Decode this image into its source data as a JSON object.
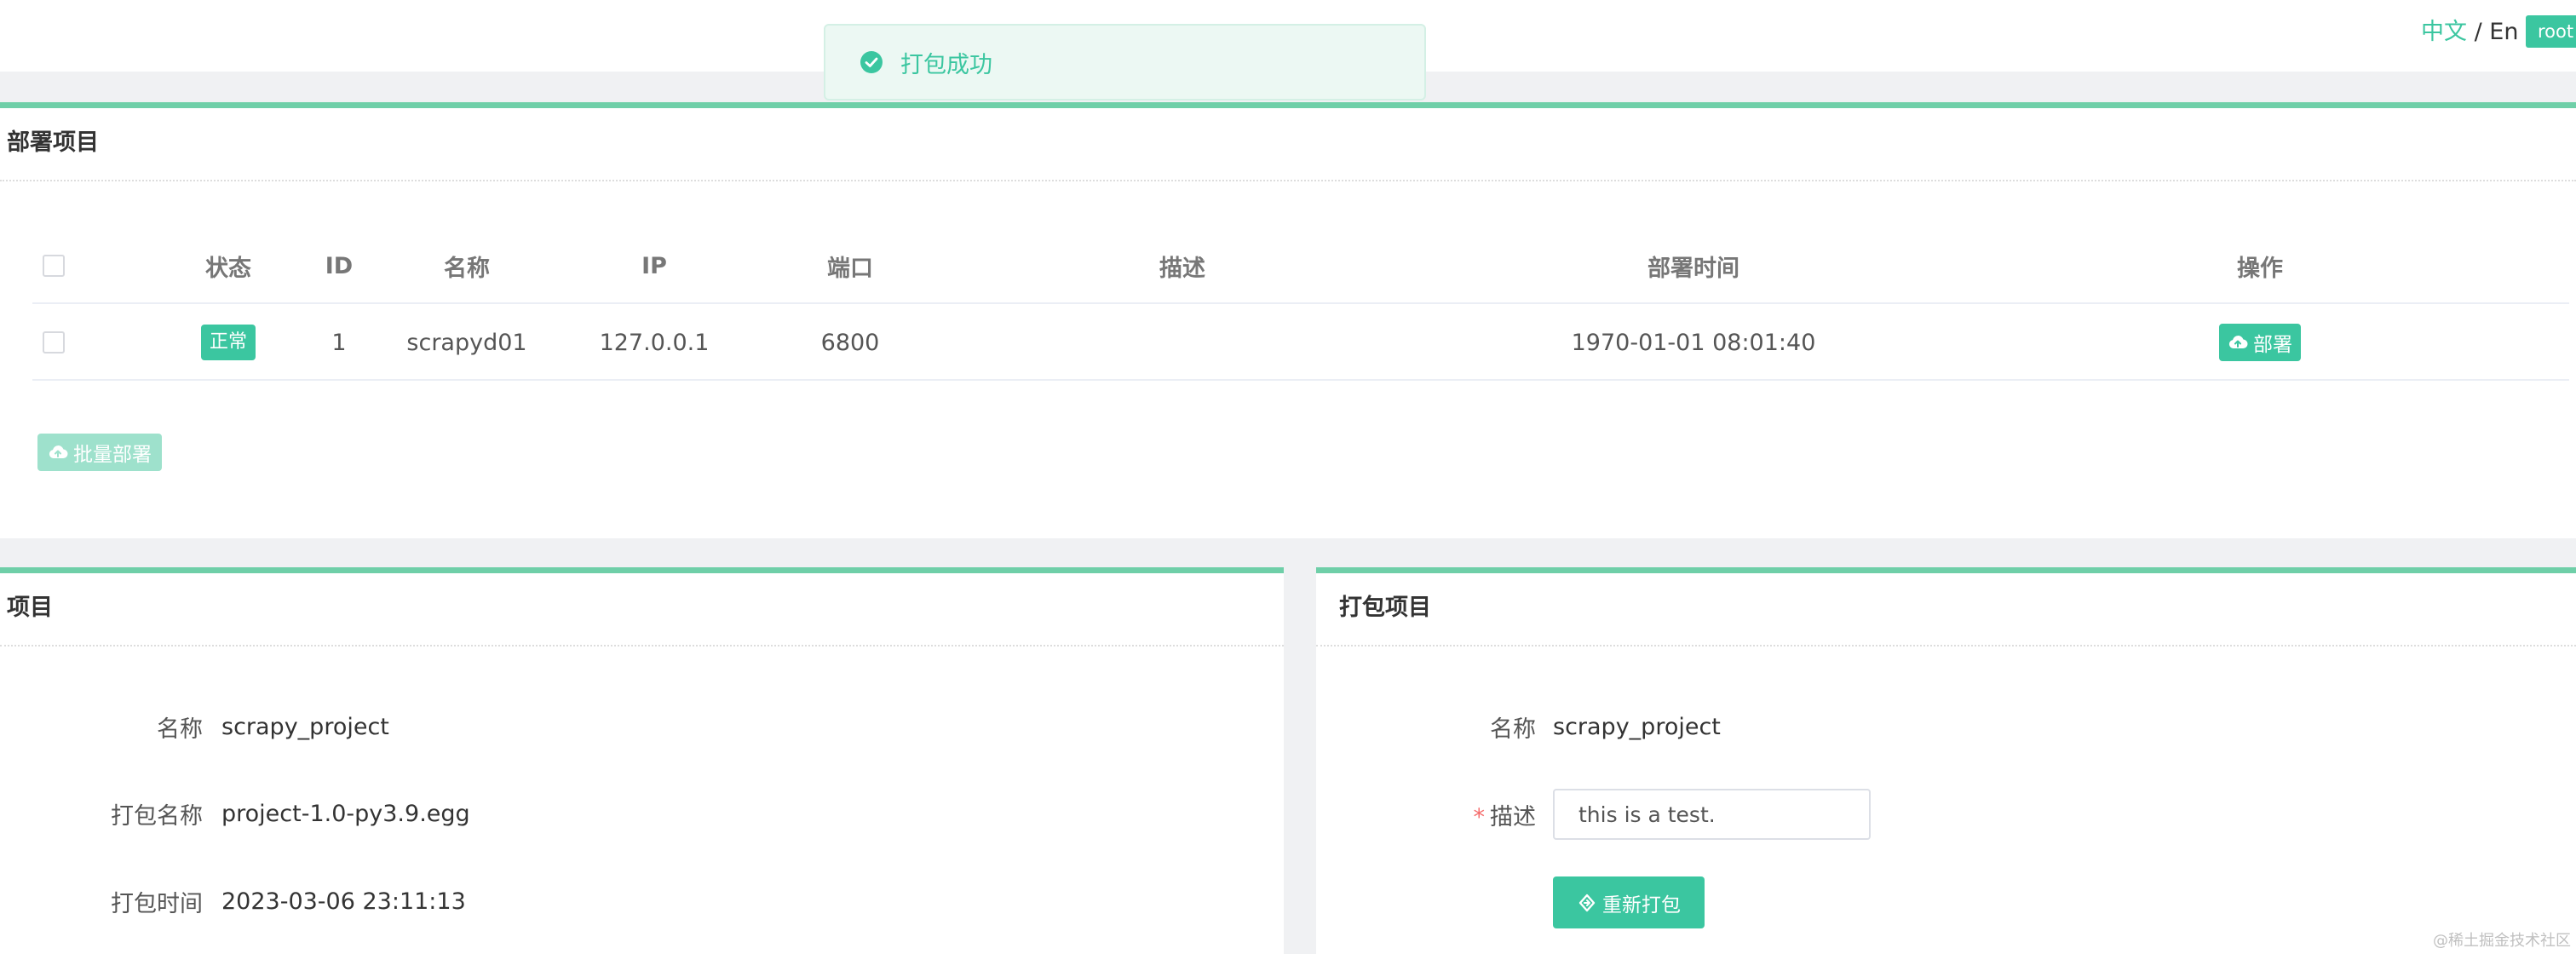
{
  "header": {
    "lang_zh": "中文",
    "lang_sep": " / ",
    "lang_en": "En",
    "user": "root"
  },
  "toast": {
    "message": "打包成功",
    "icon": "check-circle-icon"
  },
  "deploy_panel": {
    "title": "部署项目",
    "columns": [
      "状态",
      "ID",
      "名称",
      "IP",
      "端口",
      "描述",
      "部署时间",
      "操作"
    ],
    "rows": [
      {
        "status": "正常",
        "id": "1",
        "name": "scrapyd01",
        "ip": "127.0.0.1",
        "port": "6800",
        "description": "",
        "deploy_time": "1970-01-01 08:01:40",
        "action": "部署"
      }
    ],
    "batch_button": "批量部署"
  },
  "project_panel": {
    "title": "项目",
    "name_label": "名称",
    "name_value": "scrapy_project",
    "package_name_label": "打包名称",
    "package_name_value": "project-1.0-py3.9.egg",
    "package_time_label": "打包时间",
    "package_time_value": "2023-03-06 23:11:13"
  },
  "package_panel": {
    "title": "打包项目",
    "name_label": "名称",
    "name_value": "scrapy_project",
    "description_label": "描述",
    "description_value": "this is a test.",
    "repack_button": "重新打包"
  },
  "watermark": "@稀土掘金技术社区",
  "colors": {
    "accent": "#3bc6a0",
    "panel_border": "#6fcfa8",
    "toast_bg": "#ecf8f3",
    "required": "#f56c6c"
  }
}
